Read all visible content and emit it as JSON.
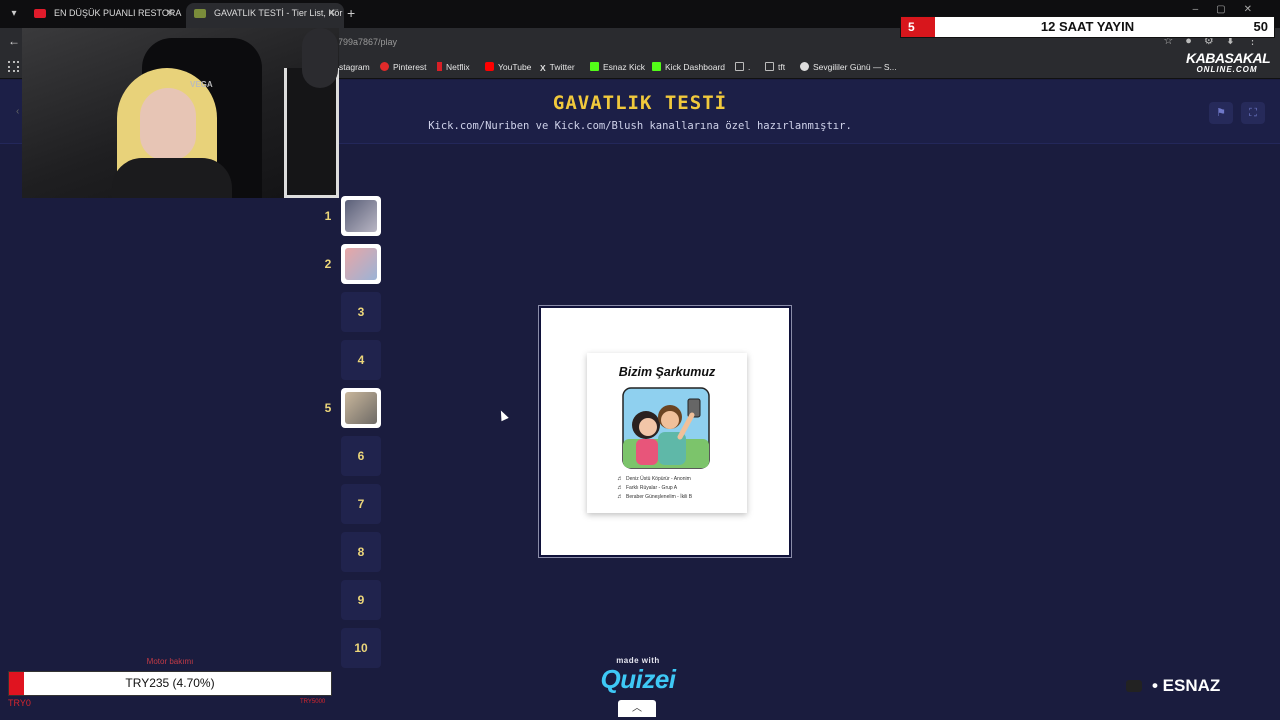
{
  "browser": {
    "tabs": [
      {
        "label": "EN DÜŞÜK PUANLI RESTORANI",
        "favicon_color": "#e01b2b"
      },
      {
        "label": "GAVATLIK TESTİ - Tier List, Kör",
        "favicon_color": "#7a8c3a"
      }
    ],
    "new_tab_label": "+",
    "url": "799a7867/play",
    "bookmarks": [
      {
        "label": "stagram",
        "icon_color": "#c8266d"
      },
      {
        "label": "Pinterest",
        "icon_color": "#e02a2a"
      },
      {
        "label": "Netflix",
        "icon_color": "#d81f26"
      },
      {
        "label": "YouTube",
        "icon_color": "#ff0000"
      },
      {
        "label": "Twitter",
        "icon_color": "#dddddd"
      },
      {
        "label": "Esnaz Kick",
        "icon_color": "#53fc18"
      },
      {
        "label": "Kick Dashboard",
        "icon_color": "#53fc18"
      },
      {
        "label": ".",
        "icon_color": "#bbbbbb"
      },
      {
        "label": "tft",
        "icon_color": "#bbbbbb"
      },
      {
        "label": "Sevgililer Günü — S...",
        "icon_color": "#dddddd"
      }
    ]
  },
  "stream_overlay": {
    "counter": "5",
    "title": "12 SAAT YAYIN",
    "number": "50",
    "brand_line1": "KABASAKAL",
    "brand_line2": "ONLINE.COM",
    "webcam_brand": "VEGA",
    "donation": {
      "label": "Motor bakımı",
      "text": "TRY235 (4.70%)",
      "progress_percent": 4.7,
      "min": "TRY0",
      "max": "TRY5000"
    },
    "channel_name": "• ESNAZ"
  },
  "page": {
    "title": "GAVATLIK TESTİ",
    "subtitle": "Kick.com/Nuriben ve Kick.com/Blush kanallarına özel hazırlanmıştır.",
    "header_buttons": [
      {
        "icon": "flag-icon"
      },
      {
        "icon": "fullscreen-icon"
      }
    ],
    "ranks": [
      {
        "number": "1",
        "filled": true,
        "thumb_colors": [
          "#5a5f78",
          "#b9b6c4"
        ]
      },
      {
        "number": "2",
        "filled": true,
        "thumb_colors": [
          "#e8a6a6",
          "#9bb3d6"
        ]
      },
      {
        "number": "3",
        "filled": false
      },
      {
        "number": "4",
        "filled": false
      },
      {
        "number": "5",
        "filled": true,
        "thumb_colors": [
          "#c9b79c",
          "#6e6a66"
        ]
      },
      {
        "number": "6",
        "filled": false
      },
      {
        "number": "7",
        "filled": false
      },
      {
        "number": "8",
        "filled": false
      },
      {
        "number": "9",
        "filled": false
      },
      {
        "number": "10",
        "filled": false
      }
    ],
    "current_card": {
      "title": "Bizim Şarkumuz",
      "songs": [
        "Deniz Üstü Köpürür - Anonim",
        "Farklı Rüyalar - Grup A",
        "Beraber Güneşlenelim - İkili B"
      ]
    },
    "footer": {
      "made_with": "made with",
      "logo": "Quizei"
    }
  },
  "colors": {
    "page_bg": "#1a1c3e",
    "title_yellow": "#f1c93c",
    "accent_cyan": "#3ec8f5",
    "overlay_red": "#d8161c"
  }
}
